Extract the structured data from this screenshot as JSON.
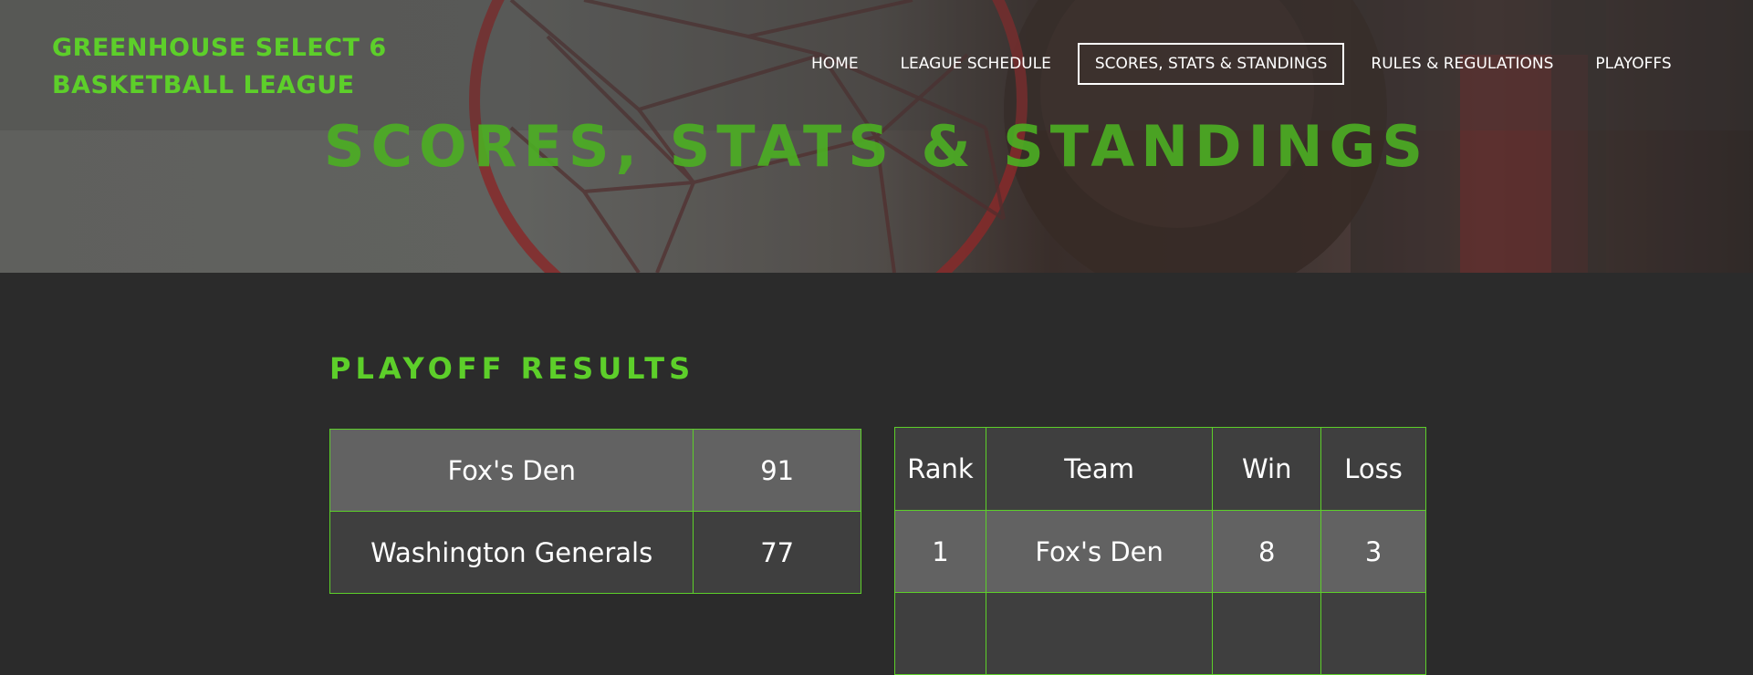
{
  "header": {
    "site_title_line1": "GREENHOUSE SELECT 6",
    "site_title_line2": "BASKETBALL LEAGUE",
    "hero_heading": "SCORES, STATS & STANDINGS"
  },
  "nav": {
    "items": [
      {
        "label": "HOME"
      },
      {
        "label": "LEAGUE SCHEDULE"
      },
      {
        "label": "SCORES, STATS & STANDINGS",
        "active": true
      },
      {
        "label": "RULES & REGULATIONS"
      },
      {
        "label": "PLAYOFFS"
      }
    ]
  },
  "main": {
    "section_title": "PLAYOFF RESULTS",
    "results": [
      {
        "team": "Fox's Den",
        "score": "91"
      },
      {
        "team": "Washington Generals",
        "score": "77"
      }
    ],
    "standings": {
      "headers": {
        "rank": "Rank",
        "team": "Team",
        "win": "Win",
        "loss": "Loss"
      },
      "rows": [
        {
          "rank": "1",
          "team": "Fox's Den",
          "win": "8",
          "loss": "3"
        },
        {
          "rank": "",
          "team": "",
          "win": "",
          "loss": ""
        }
      ]
    }
  },
  "colors": {
    "accent": "#5dcf2a",
    "background": "#2b2b2b",
    "row_light": "#626262",
    "row_dark": "#3f3f3f"
  }
}
